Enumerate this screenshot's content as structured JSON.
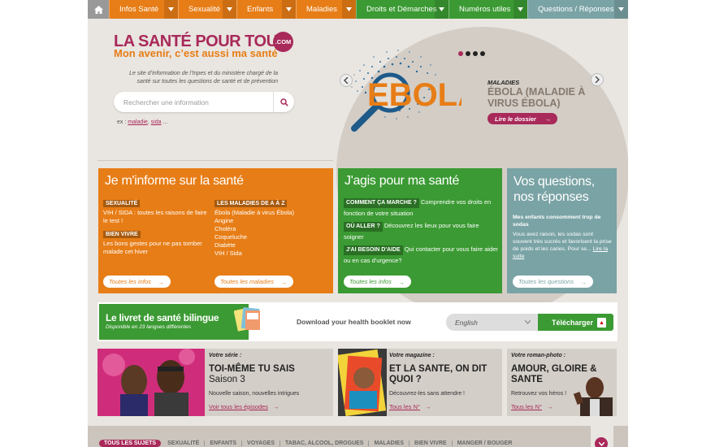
{
  "nav": {
    "home_icon": "home-icon",
    "items": [
      {
        "label": "Infos Santé",
        "color": "#e77d16"
      },
      {
        "label": "Sexualité",
        "color": "#e77d16"
      },
      {
        "label": "Enfants",
        "color": "#e77d16"
      },
      {
        "label": "Maladies",
        "color": "#e77d16"
      },
      {
        "label": "Droits et Démarches",
        "color": "#3b9a33"
      },
      {
        "label": "Numéros utiles",
        "color": "#3b9a33"
      },
      {
        "label": "Questions / Réponses",
        "color": "#7aa3a5"
      }
    ]
  },
  "header": {
    "logo_title": "LA SANTÉ POUR TOUS",
    "logo_com": ".COM",
    "logo_sub": "Mon avenir, c’est aussi ma santé",
    "tagline": "Le site d’information de l’Inpes et du ministère chargé de la santé sur toutes les questions de santé et de prévention",
    "search_placeholder": "Rechercher une information",
    "examples_prefix": "ex :",
    "examples": [
      "maladie",
      "sida"
    ],
    "examples_suffix": "..."
  },
  "slider": {
    "image_text": "EBOLA",
    "category": "MALADIES",
    "title": "ÉBOLA (MALADIE À VIRUS ÉBOLA)",
    "button": "Lire le dossier",
    "dots": 4,
    "active_dot": 0
  },
  "box_inform": {
    "title": "Je m'informe sur la santé",
    "color": "#e77d16",
    "col1": [
      {
        "tag": "SEXUALITÉ",
        "text": "VIH / SIDA : toutes les raisons de faire le test !"
      },
      {
        "tag": "BIEN VIVRE",
        "text": "Les bons gestes pour ne pas tomber malade cet hiver"
      }
    ],
    "col2_tag": "LES MALADIES DE A À Z",
    "col2_items": [
      "Ébola (Maladie à virus Ébola)",
      "Angine",
      "Choléra",
      "Coqueluche",
      "Diabète",
      "VIH / Sida"
    ],
    "btn1": "Toutes les infos",
    "btn2": "Toutes les maladies"
  },
  "box_act": {
    "title": "J'agis pour ma santé",
    "color": "#3b9a33",
    "items": [
      {
        "tag": "COMMENT ÇA MARCHE ?",
        "text": "Comprendre vos droits en fonction de votre situation"
      },
      {
        "tag": "OÙ ALLER ?",
        "text": "Découvrez les lieux pour vous faire soigner"
      },
      {
        "tag": "J'AI BESOIN D'AIDE",
        "text": "Qui contacter pour vous faire aider ou en cas d'urgence?"
      }
    ],
    "btn": "Toutes les infos"
  },
  "box_qa": {
    "title": "Vos questions, nos réponses",
    "color": "#7aa3a5",
    "question": "Mes enfants consomment trop de sodas",
    "answer": "Vous avez raison, les sodas sont souvent très sucrés et favorisent la prise de poids et les caries. Pour se...",
    "link": "Lire la suite",
    "btn": "Toutes les questions"
  },
  "livret": {
    "title": "Le livret de santé bilingue",
    "subtitle": "Disponible en 23 langues différentes",
    "download_text": "Download your health booklet now",
    "language": "English",
    "button": "Télécharger",
    "pdf_icon": "pdf-icon"
  },
  "promos": [
    {
      "label": "Votre série :",
      "title": "TOI-MÊME TU SAIS",
      "title2": "Saison 3",
      "desc": "Nouvelle saison, nouvelles intrigues",
      "link": "Voir tous les épisodes"
    },
    {
      "label": "Votre magazine :",
      "title": "ET LA SANTE, ON DIT QUOI ?",
      "desc": "Découvrez-les sans attendre !",
      "link": "Tous les N°"
    },
    {
      "label": "Votre roman-photo :",
      "title": "AMOUR, GLOIRE & SANTE",
      "desc": "Retrouvez vos héros !",
      "link": "Tous les N°"
    }
  ],
  "bottom_tags": [
    "TOUS LES SUJETS",
    "SEXUALITÉ",
    "ENFANTS",
    "VOYAGES",
    "TABAC, ALCOOL, DROGUES",
    "MALADIES",
    "BIEN VIVRE",
    "MANGER / BOUGER"
  ],
  "arrow_char": "→"
}
